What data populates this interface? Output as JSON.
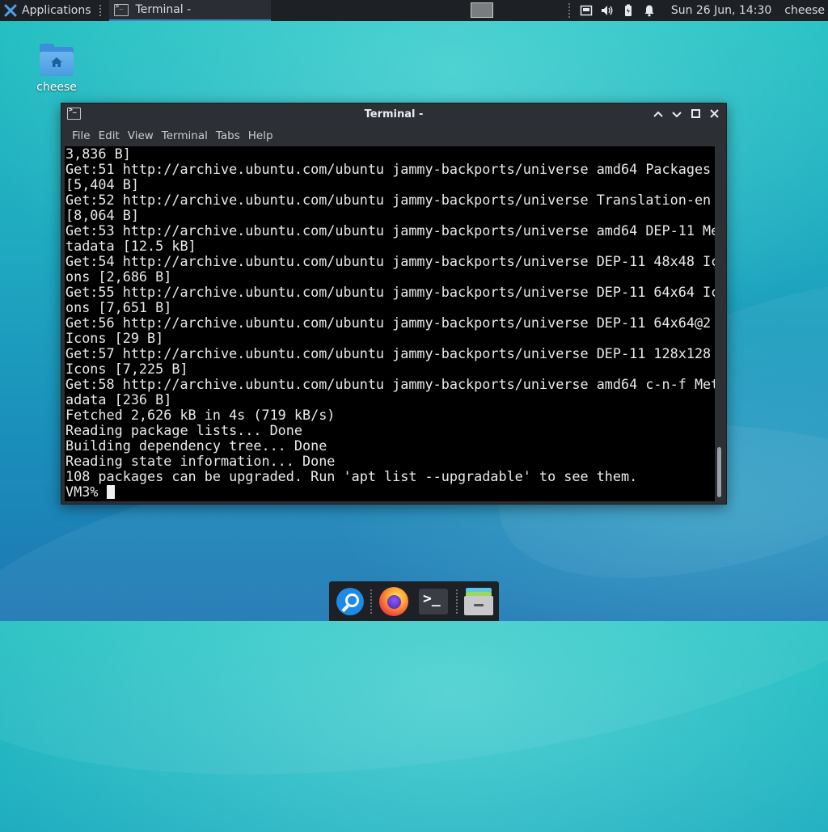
{
  "top_panel": {
    "applications_label": "Applications",
    "task_title": "Terminal -",
    "clock": "Sun 26 Jun, 14:30",
    "user": "cheese"
  },
  "desktop": {
    "home_icon_label": "cheese"
  },
  "window": {
    "title": "Terminal -",
    "menu": [
      "File",
      "Edit",
      "View",
      "Terminal",
      "Tabs",
      "Help"
    ],
    "terminal_lines": [
      "3,836 B]",
      "Get:51 http://archive.ubuntu.com/ubuntu jammy-backports/universe amd64 Packages",
      "[5,404 B]",
      "Get:52 http://archive.ubuntu.com/ubuntu jammy-backports/universe Translation-en",
      "[8,064 B]",
      "Get:53 http://archive.ubuntu.com/ubuntu jammy-backports/universe amd64 DEP-11 Me",
      "tadata [12.5 kB]",
      "Get:54 http://archive.ubuntu.com/ubuntu jammy-backports/universe DEP-11 48x48 Ic",
      "ons [2,686 B]",
      "Get:55 http://archive.ubuntu.com/ubuntu jammy-backports/universe DEP-11 64x64 Ic",
      "ons [7,651 B]",
      "Get:56 http://archive.ubuntu.com/ubuntu jammy-backports/universe DEP-11 64x64@2",
      "Icons [29 B]",
      "Get:57 http://archive.ubuntu.com/ubuntu jammy-backports/universe DEP-11 128x128",
      "Icons [7,225 B]",
      "Get:58 http://archive.ubuntu.com/ubuntu jammy-backports/universe amd64 c-n-f Met",
      "adata [236 B]",
      "Fetched 2,626 kB in 4s (719 kB/s)",
      "Reading package lists... Done",
      "Building dependency tree... Done",
      "Reading state information... Done",
      "108 packages can be upgraded. Run 'apt list --upgradable' to see them."
    ],
    "prompt": "VM3% "
  },
  "dock": {
    "items": [
      "search-icon",
      "firefox-icon",
      "terminal-icon",
      "file-manager-icon"
    ]
  },
  "colors": {
    "panel_bg": "#1d2024",
    "accent": "#3d86c6",
    "terminal_bg": "#000000",
    "terminal_fg": "#eaeaea"
  }
}
